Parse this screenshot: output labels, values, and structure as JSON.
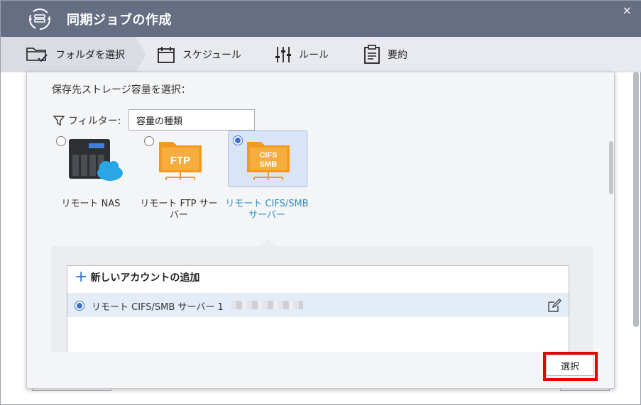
{
  "window": {
    "title": "同期ジョブの作成",
    "close_glyph": "×"
  },
  "steps": [
    {
      "label": "フォルダを選択",
      "icon": "folder-check-icon",
      "active": true
    },
    {
      "label": "スケジュール",
      "icon": "calendar-icon",
      "active": false
    },
    {
      "label": "ルール",
      "icon": "sliders-icon",
      "active": false
    },
    {
      "label": "要約",
      "icon": "clipboard-icon",
      "active": false
    }
  ],
  "popup": {
    "heading": "保存先ストレージ容量を選択：",
    "filter_label": "フィルター:",
    "filter_value": "容量の種類",
    "options": [
      {
        "label": "リモート NAS",
        "icon": "nas-cloud-icon",
        "selected": false
      },
      {
        "label": "リモート FTP サーバー",
        "icon": "ftp-folder-icon",
        "icon_text": "FTP",
        "selected": false
      },
      {
        "label": "リモート CIFS/SMB サーバー",
        "icon": "smb-folder-icon",
        "icon_text_1": "CIFS",
        "icon_text_2": "SMB",
        "selected": true
      }
    ],
    "add_account_label": "新しいアカウントの追加",
    "account_name": "リモート CIFS/SMB サーバー 1",
    "select_button": "選択"
  },
  "colors": {
    "titlebar": "#666e84",
    "accent_blue": "#2f6fd8",
    "folder_orange": "#f39a1e",
    "highlight_red": "#e60000",
    "selected_label": "#2a91c6"
  }
}
